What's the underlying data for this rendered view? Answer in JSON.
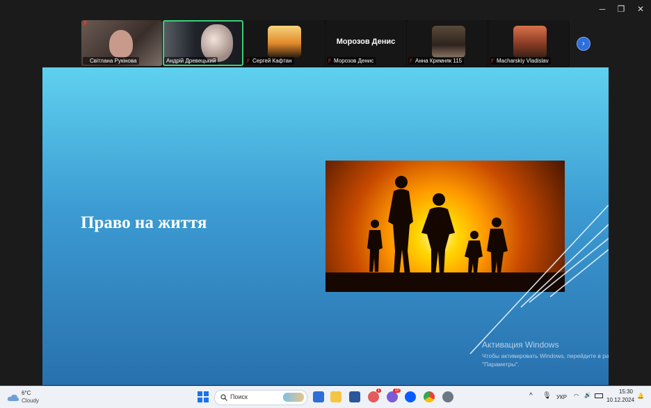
{
  "window": {
    "minimize_glyph": "─",
    "restore_glyph": "❐",
    "close_glyph": "✕"
  },
  "participants": [
    {
      "name": "Світлана Рукінова",
      "muted": true,
      "type": "video"
    },
    {
      "name": "Андрій Древецький",
      "muted": false,
      "type": "video",
      "active_speaker": true
    },
    {
      "name": "Сергей Кафтан",
      "muted": true,
      "type": "avatar"
    },
    {
      "name": "Морозов Денис",
      "muted": true,
      "type": "name-only",
      "display_name": "Морозов Денис"
    },
    {
      "name": "Анна Кремняк 115",
      "muted": true,
      "type": "avatar"
    },
    {
      "name": "Macharskiy Vladislav",
      "muted": true,
      "type": "avatar"
    }
  ],
  "participant_next": "›",
  "slide": {
    "title": "Право на життя"
  },
  "activation": {
    "title": "Активация Windows",
    "text": "Чтобы активировать Windows, перейдите в раздел \"Параметры\"."
  },
  "taskbar": {
    "weather_temp": "6°C",
    "weather_desc": "Cloudy",
    "search_placeholder": "Поиск",
    "language": "УКР",
    "time": "15:30",
    "date": "10.12.2024",
    "telegram_badge": "1",
    "viber_badge": "10"
  },
  "colors": {
    "accent": "#3cd07a",
    "slide_top": "#5fd1ef",
    "slide_bottom": "#2870ae"
  }
}
